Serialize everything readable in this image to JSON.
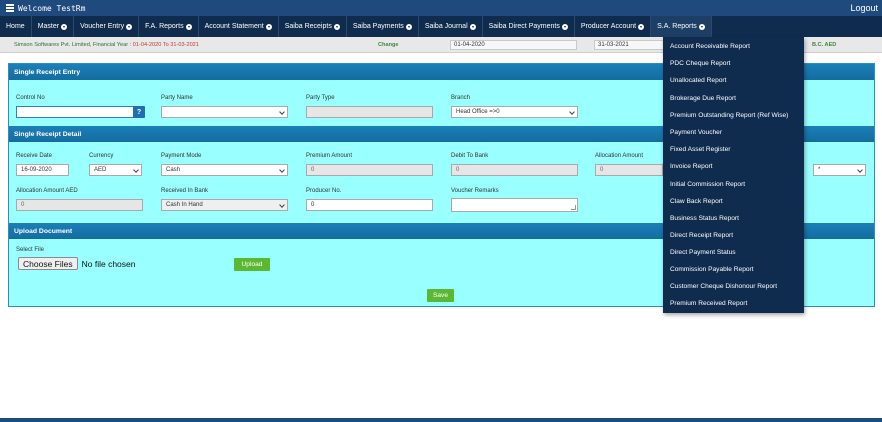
{
  "topbar": {
    "welcome": "Welcome TestRm",
    "logout": "Logout"
  },
  "nav": [
    {
      "label": "Home",
      "has_dropdown": false
    },
    {
      "label": "Master",
      "has_dropdown": true
    },
    {
      "label": "Voucher Entry",
      "has_dropdown": true
    },
    {
      "label": "F.A. Reports",
      "has_dropdown": true
    },
    {
      "label": "Account Statement",
      "has_dropdown": true
    },
    {
      "label": "Saiba Receipts",
      "has_dropdown": true
    },
    {
      "label": "Saiba Payments",
      "has_dropdown": true
    },
    {
      "label": "Saiba Journal",
      "has_dropdown": true
    },
    {
      "label": "Saiba Direct Payments",
      "has_dropdown": true
    },
    {
      "label": "Producer Account",
      "has_dropdown": true
    },
    {
      "label": "S.A. Reports",
      "has_dropdown": true
    }
  ],
  "infobar": {
    "company": "Simson Softwares Pvt. Limited, Financial Year : ",
    "fy": "01-04-2020 To 31-03-2021",
    "change": "Change",
    "date_from": "01-04-2020",
    "date_to": "31-03-2021",
    "bc": "B.C. AED"
  },
  "sections": {
    "entry": "Single Receipt Entry",
    "detail": "Single Receipt Detail",
    "upload": "Upload Document"
  },
  "entry": {
    "control_no_label": "Control No",
    "control_no_value": "",
    "help_btn": "?",
    "party_name_label": "Party Name",
    "party_name_value": "",
    "party_type_label": "Party Type",
    "party_type_value": "",
    "branch_label": "Branch",
    "branch_value": "Head Office =>0"
  },
  "detail": {
    "receive_date_label": "Receive Date",
    "receive_date_value": "16-09-2020",
    "currency_label": "Currency",
    "currency_value": "AED",
    "payment_mode_label": "Payment Mode",
    "payment_mode_value": "Cash",
    "premium_amount_label": "Premium Amount",
    "premium_amount_value": "0",
    "debit_to_bank_label": "Debit To Bank",
    "debit_to_bank_value": "0",
    "allocation_amount_label": "Allocation Amount",
    "allocation_amount_value": "0",
    "extra_select_value": "*",
    "allocation_amount_aed_label": "Allocation Amount AED",
    "allocation_amount_aed_value": "0",
    "received_in_bank_label": "Received In Bank",
    "received_in_bank_value": "Cash In Hand",
    "producer_no_label": "Producer No.",
    "producer_no_value": "0",
    "voucher_remarks_label": "Voucher Remarks",
    "voucher_remarks_value": ""
  },
  "upload": {
    "select_file_label": "Select File",
    "choose_files": "Choose Files",
    "no_file": "No file chosen",
    "upload_btn": "Upload"
  },
  "save_btn": "Save",
  "sa_reports_menu": [
    "Account Receivable Report",
    "PDC Cheque Report",
    "Unallocated Report",
    "Brokerage Due Report",
    "Premium Outstanding Report (Ref Wise)",
    "Payment Voucher",
    "Fixed Asset Register",
    "Invoice Report",
    "Initial Commission Report",
    "Claw Back Report",
    "Business Status Report",
    "Direct Receipt Report",
    "Direct Payment Status",
    "Commission Payable Report",
    "Customer Cheque Dishonour Report",
    "Premium Received Report"
  ]
}
